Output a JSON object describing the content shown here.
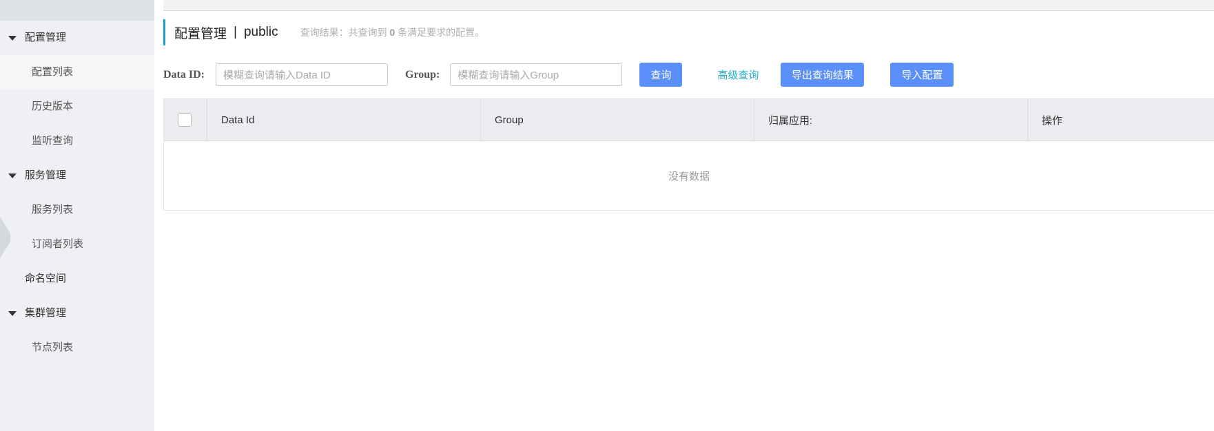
{
  "sidebar": {
    "groups": [
      {
        "label": "配置管理",
        "items": [
          "配置列表",
          "历史版本",
          "监听查询"
        ]
      },
      {
        "label": "服务管理",
        "items": [
          "服务列表",
          "订阅者列表"
        ]
      },
      {
        "label": "命名空间"
      },
      {
        "label": "集群管理",
        "items": [
          "节点列表"
        ]
      }
    ],
    "active_item": "配置列表"
  },
  "header": {
    "title": "配置管理",
    "separator": "|",
    "namespace": "public",
    "result_prefix": "查询结果：共查询到",
    "result_count": "0",
    "result_suffix": "条满足要求的配置。"
  },
  "query": {
    "data_id_label": "Data ID:",
    "data_id_placeholder": "模糊查询请输入Data ID",
    "group_label": "Group:",
    "group_placeholder": "模糊查询请输入Group",
    "search_button": "查询",
    "advanced_link": "高级查询",
    "export_button": "导出查询结果",
    "import_button": "导入配置"
  },
  "table": {
    "columns": [
      "Data Id",
      "Group",
      "归属应用:",
      "操作"
    ],
    "empty_text": "没有数据"
  },
  "colors": {
    "primary": "#5b8ff9",
    "accent": "#1aa0c7",
    "link": "#1fb1c8"
  }
}
